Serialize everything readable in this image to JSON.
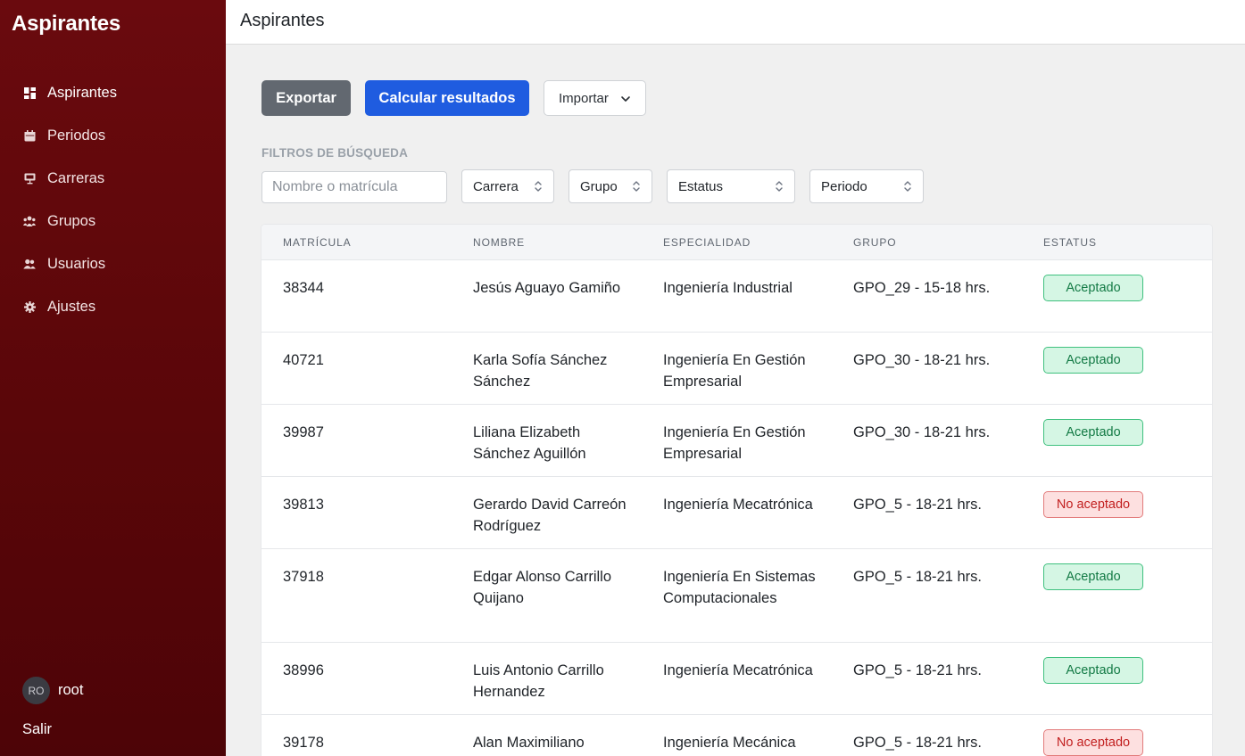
{
  "app": {
    "brand": "Aspirantes"
  },
  "sidebar": {
    "items": [
      {
        "label": "Aspirantes",
        "icon": "dashboard-icon",
        "active": true
      },
      {
        "label": "Periodos",
        "icon": "calendar-icon",
        "active": false
      },
      {
        "label": "Carreras",
        "icon": "presentation-icon",
        "active": false
      },
      {
        "label": "Grupos",
        "icon": "group-icon",
        "active": false
      },
      {
        "label": "Usuarios",
        "icon": "users-icon",
        "active": false
      },
      {
        "label": "Ajustes",
        "icon": "gear-icon",
        "active": false
      }
    ],
    "user": {
      "initials": "RO",
      "name": "root"
    },
    "logout_label": "Salir"
  },
  "header": {
    "title": "Aspirantes"
  },
  "actions": {
    "export_label": "Exportar",
    "calculate_label": "Calcular resultados",
    "import_label": "Importar"
  },
  "filters": {
    "title": "FILTROS DE BÚSQUEDA",
    "search_placeholder": "Nombre o matrícula",
    "search_value": "",
    "carrera": "Carrera",
    "grupo": "Grupo",
    "estatus": "Estatus",
    "periodo": "Periodo"
  },
  "table": {
    "columns": [
      "MATRÍCULA",
      "NOMBRE",
      "ESPECIALIDAD",
      "GRUPO",
      "ESTATUS"
    ],
    "rows": [
      {
        "matricula": "38344",
        "nombre": "Jesús Aguayo Gamiño",
        "especialidad": "Ingeniería Industrial",
        "grupo": "GPO_29 - 15-18 hrs.",
        "estatus": "Aceptado"
      },
      {
        "matricula": "40721",
        "nombre": "Karla Sofía Sánchez Sánchez",
        "especialidad": "Ingeniería En Gestión Empresarial",
        "grupo": "GPO_30 - 18-21 hrs.",
        "estatus": "Aceptado"
      },
      {
        "matricula": "39987",
        "nombre": "Liliana Elizabeth Sánchez Aguillón",
        "especialidad": "Ingeniería En Gestión Empresarial",
        "grupo": "GPO_30 - 18-21 hrs.",
        "estatus": "Aceptado"
      },
      {
        "matricula": "39813",
        "nombre": "Gerardo David Carreón Rodríguez",
        "especialidad": "Ingeniería Mecatrónica",
        "grupo": "GPO_5 - 18-21 hrs.",
        "estatus": "No aceptado"
      },
      {
        "matricula": "37918",
        "nombre": "Edgar Alonso Carrillo Quijano",
        "especialidad": "Ingeniería En Sistemas Computacionales",
        "grupo": "GPO_5 - 18-21 hrs.",
        "estatus": "Aceptado"
      },
      {
        "matricula": "38996",
        "nombre": "Luis Antonio Carrillo Hernandez",
        "especialidad": "Ingeniería Mecatrónica",
        "grupo": "GPO_5 - 18-21 hrs.",
        "estatus": "Aceptado"
      },
      {
        "matricula": "39178",
        "nombre": "Alan Maximiliano",
        "especialidad": "Ingeniería Mecánica",
        "grupo": "GPO_5 - 18-21 hrs.",
        "estatus": "No aceptado"
      }
    ]
  },
  "colors": {
    "sidebar": "#5a0609",
    "primary": "#1f5ce0",
    "secondary": "#626870",
    "accepted": "#137a45",
    "rejected": "#c22020"
  }
}
